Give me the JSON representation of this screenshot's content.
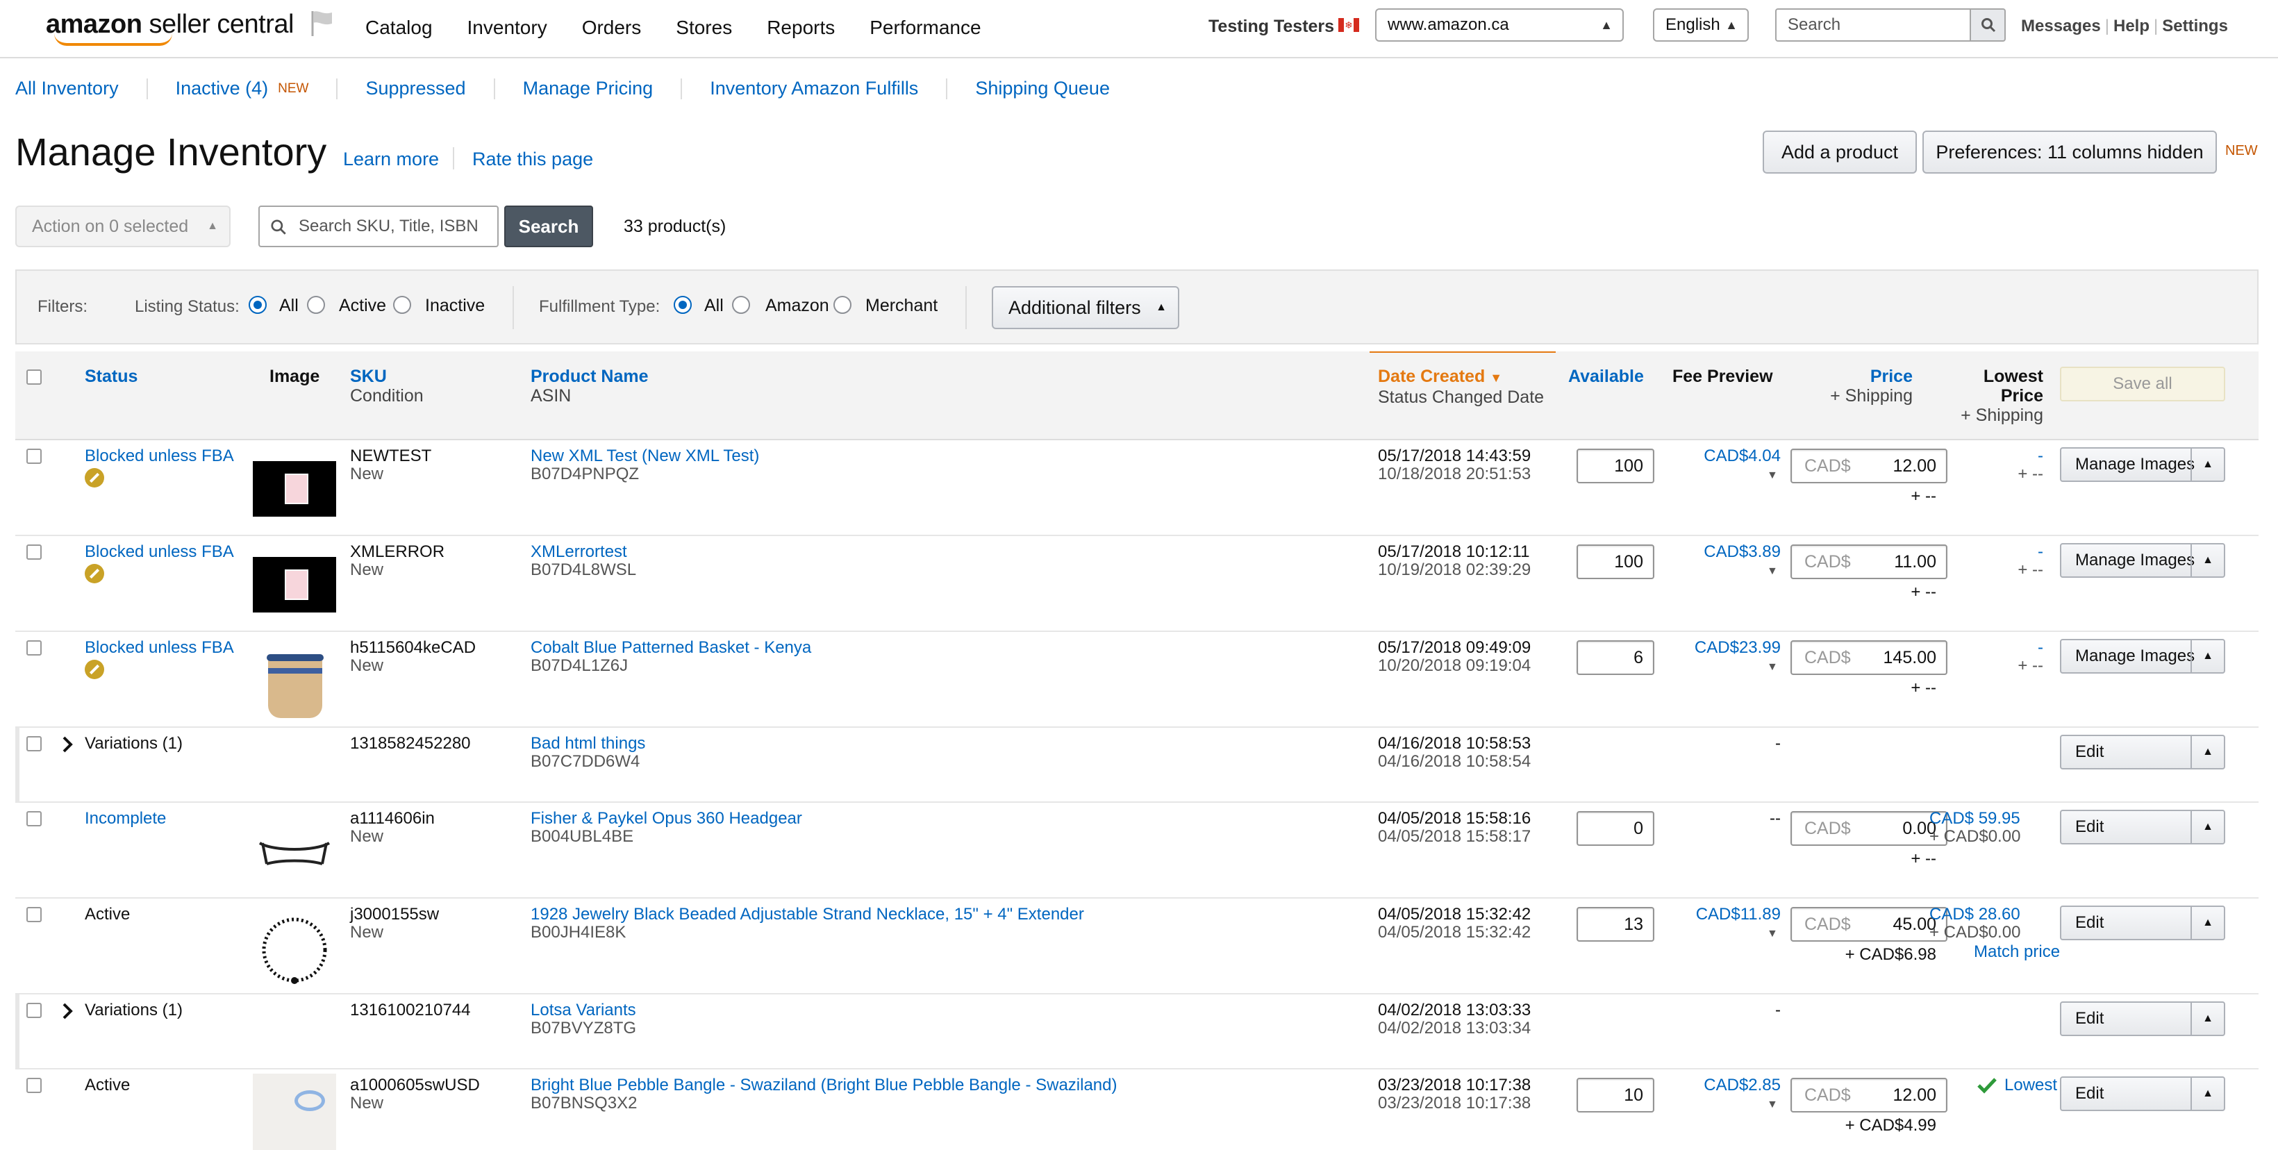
{
  "brand": {
    "name": "amazon",
    "suffix": "seller central"
  },
  "top_nav": [
    "Catalog",
    "Inventory",
    "Orders",
    "Stores",
    "Reports",
    "Performance"
  ],
  "account": {
    "name": "Testing Testers",
    "marketplace": "www.amazon.ca",
    "language": "English"
  },
  "top_search": {
    "placeholder": "Search"
  },
  "top_links": [
    "Messages",
    "Help",
    "Settings"
  ],
  "sub_nav": [
    {
      "label": "All Inventory"
    },
    {
      "label": "Inactive (4)",
      "badge": "NEW"
    },
    {
      "label": "Suppressed"
    },
    {
      "label": "Manage Pricing"
    },
    {
      "label": "Inventory Amazon Fulfills"
    },
    {
      "label": "Shipping Queue"
    }
  ],
  "page": {
    "title": "Manage Inventory",
    "learn_more": "Learn more",
    "rate": "Rate this page",
    "add_product": "Add a product",
    "preferences": "Preferences: 11 columns hidden",
    "preferences_badge": "NEW"
  },
  "action_row": {
    "action_select": "Action on 0 selected",
    "search_placeholder": "Search SKU, Title, ISBN",
    "search_button": "Search",
    "count": "33 product(s)"
  },
  "filters": {
    "label": "Filters:",
    "listing_status": {
      "label": "Listing Status:",
      "options": [
        "All",
        "Active",
        "Inactive"
      ],
      "selected": "All"
    },
    "fulfillment_type": {
      "label": "Fulfillment Type:",
      "options": [
        "All",
        "Amazon",
        "Merchant"
      ],
      "selected": "All"
    },
    "additional": "Additional filters"
  },
  "columns": {
    "status": "Status",
    "image": "Image",
    "sku": "SKU",
    "sku_sub": "Condition",
    "product": "Product Name",
    "product_sub": "ASIN",
    "date": "Date Created",
    "date_sub": "Status Changed Date",
    "available": "Available",
    "fee": "Fee Preview",
    "price": "Price",
    "price_sub": "+ Shipping",
    "lowest": "Lowest",
    "lowest2": "Price",
    "lowest_sub": "+ Shipping",
    "save_all": "Save all"
  },
  "rows": [
    {
      "status": "Blocked unless FBA",
      "sku": "NEWTEST",
      "condition": "New",
      "name": "New XML Test (New XML Test)",
      "asin": "B07D4PNPQZ",
      "created": "05/17/2018 14:43:59",
      "changed": "10/18/2018 20:51:53",
      "available": "100",
      "fee": "CAD$4.04",
      "currency": "CAD$",
      "price": "12.00",
      "shipping": "+ --",
      "lowest": "-",
      "lowest_ship": "+ --",
      "action": "Manage Images"
    },
    {
      "status": "Blocked unless FBA",
      "sku": "XMLERROR",
      "condition": "New",
      "name": "XMLerrortest",
      "asin": "B07D4L8WSL",
      "created": "05/17/2018 10:12:11",
      "changed": "10/19/2018 02:39:29",
      "available": "100",
      "fee": "CAD$3.89",
      "currency": "CAD$",
      "price": "11.00",
      "shipping": "+ --",
      "lowest": "-",
      "lowest_ship": "+ --",
      "action": "Manage Images"
    },
    {
      "status": "Blocked unless FBA",
      "sku": "h5115604keCAD",
      "condition": "New",
      "name": "Cobalt Blue Patterned Basket - Kenya",
      "asin": "B07D4L1Z6J",
      "created": "05/17/2018 09:49:09",
      "changed": "10/20/2018 09:19:04",
      "available": "6",
      "fee": "CAD$23.99",
      "currency": "CAD$",
      "price": "145.00",
      "shipping": "+ --",
      "lowest": "-",
      "lowest_ship": "+ --",
      "action": "Manage Images"
    },
    {
      "status": "Variations (1)",
      "sku": "1318582452280",
      "name": "Bad html things",
      "asin": "B07C7DD6W4",
      "created": "04/16/2018 10:58:53",
      "changed": "04/16/2018 10:58:54",
      "fee": "-",
      "action": "Edit"
    },
    {
      "status": "Incomplete",
      "sku": "a1114606in",
      "condition": "New",
      "name": "Fisher & Paykel Opus 360 Headgear",
      "asin": "B004UBL4BE",
      "created": "04/05/2018 15:58:16",
      "changed": "04/05/2018 15:58:17",
      "available": "0",
      "fee": "--",
      "currency": "CAD$",
      "price": "0.00",
      "shipping": "+ --",
      "lowest": "CAD$ 59.95",
      "lowest_ship": "+ CAD$0.00",
      "action": "Edit"
    },
    {
      "status": "Active",
      "sku": "j3000155sw",
      "condition": "New",
      "name": "1928 Jewelry Black Beaded Adjustable Strand Necklace, 15\" + 4\" Extender",
      "asin": "B00JH4IE8K",
      "created": "04/05/2018 15:32:42",
      "changed": "04/05/2018 15:32:42",
      "available": "13",
      "fee": "CAD$11.89",
      "currency": "CAD$",
      "price": "45.00",
      "shipping": "+ CAD$6.98",
      "lowest": "CAD$ 28.60",
      "lowest_ship": "+ CAD$0.00",
      "match": "Match price",
      "action": "Edit"
    },
    {
      "status": "Variations (1)",
      "sku": "1316100210744",
      "name": "Lotsa Variants",
      "asin": "B07BVYZ8TG",
      "created": "04/02/2018 13:03:33",
      "changed": "04/02/2018 13:03:34",
      "fee": "-",
      "action": "Edit"
    },
    {
      "status": "Active",
      "sku": "a1000605swUSD",
      "condition": "New",
      "name": "Bright Blue Pebble Bangle - Swaziland (Bright Blue Pebble Bangle - Swaziland)",
      "asin": "B07BNSQ3X2",
      "created": "03/23/2018 10:17:38",
      "changed": "03/23/2018 10:17:38",
      "available": "10",
      "fee": "CAD$2.85",
      "currency": "CAD$",
      "price": "12.00",
      "shipping": "+ CAD$4.99",
      "lowest": "Lowest",
      "action": "Edit"
    }
  ],
  "colors": {
    "link": "#0066c0",
    "accent_orange": "#c45500",
    "sort_orange": "#e47911"
  }
}
